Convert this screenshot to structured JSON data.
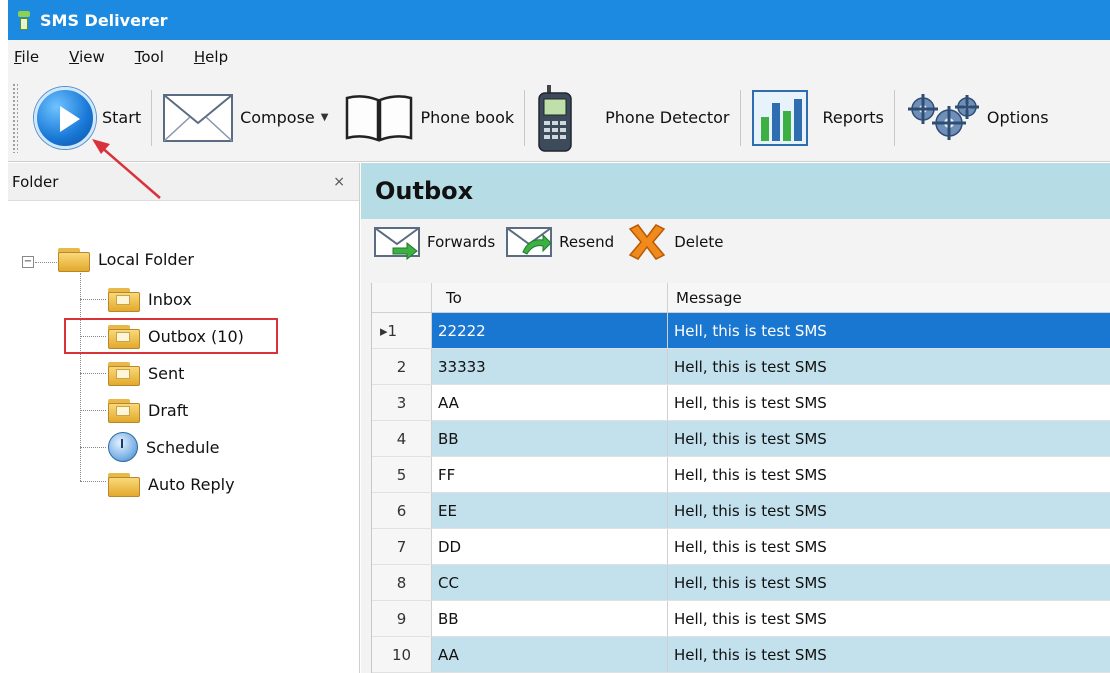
{
  "window": {
    "title": "SMS Deliverer"
  },
  "menu": [
    {
      "prefix": "",
      "underline": "F",
      "rest": "ile"
    },
    {
      "prefix": "",
      "underline": "V",
      "rest": "iew"
    },
    {
      "prefix": "",
      "underline": "T",
      "rest": "ool"
    },
    {
      "prefix": "",
      "underline": "H",
      "rest": "elp"
    }
  ],
  "toolbar": {
    "start": "Start",
    "compose": "Compose",
    "phone_book": "Phone book",
    "phone_detector": "Phone Detector",
    "reports": "Reports",
    "options": "Options"
  },
  "folder_pane": {
    "header": "Folder",
    "close": "×",
    "expander": "⊟",
    "root": "Local Folder",
    "items": {
      "inbox": "Inbox",
      "outbox": "Outbox (10)",
      "sent": "Sent",
      "draft": "Draft",
      "schedule": "Schedule",
      "auto_reply": "Auto Reply"
    }
  },
  "main": {
    "title": "Outbox",
    "actions": {
      "forwards": "Forwards",
      "resend": "Resend",
      "delete": "Delete"
    },
    "columns": {
      "to": "To",
      "message": "Message"
    },
    "selected_marker": "▸1",
    "rows": [
      {
        "idx": "1",
        "to": "22222",
        "message": "Hell, this is test SMS"
      },
      {
        "idx": "2",
        "to": "33333",
        "message": "Hell, this is test SMS"
      },
      {
        "idx": "3",
        "to": "AA",
        "message": "Hell, this is test SMS"
      },
      {
        "idx": "4",
        "to": "BB",
        "message": "Hell, this is test SMS"
      },
      {
        "idx": "5",
        "to": "FF",
        "message": "Hell, this is test SMS"
      },
      {
        "idx": "6",
        "to": "EE",
        "message": "Hell, this is test SMS"
      },
      {
        "idx": "7",
        "to": "DD",
        "message": "Hell, this is test SMS"
      },
      {
        "idx": "8",
        "to": "CC",
        "message": "Hell, this is test SMS"
      },
      {
        "idx": "9",
        "to": "BB",
        "message": "Hell, this is test SMS"
      },
      {
        "idx": "10",
        "to": "AA",
        "message": "Hell, this is test SMS"
      }
    ]
  },
  "colors": {
    "titlebar": "#1c8ae0",
    "selection": "#1a77d1",
    "alt_row": "#c3e1ec",
    "header_band": "#b6dce6",
    "annotation_red": "#d9323a"
  }
}
